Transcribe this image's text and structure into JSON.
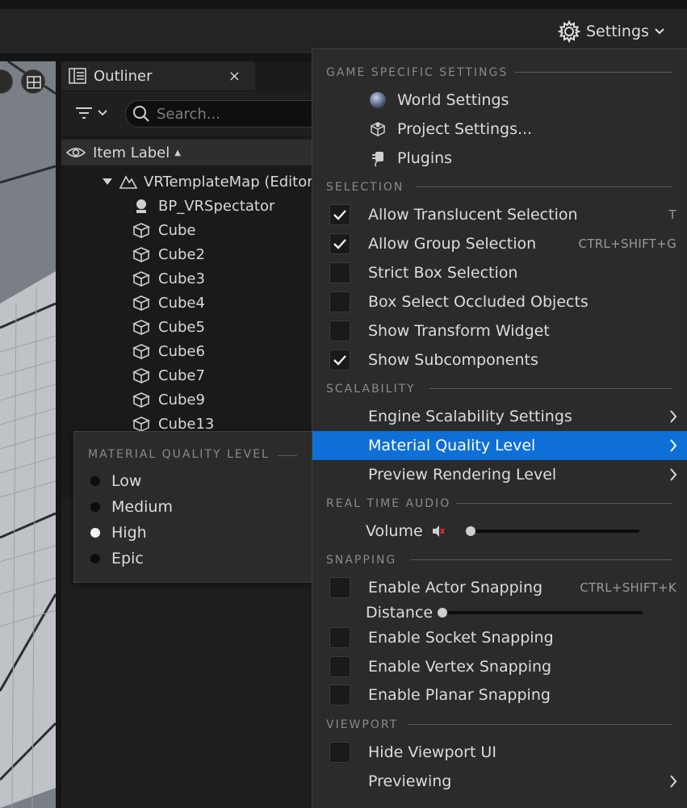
{
  "toolbar": {
    "settings_label": "Settings"
  },
  "outliner": {
    "tab_title": "Outliner",
    "close_glyph": "×",
    "search_placeholder": "Search...",
    "column_header": "Item Label",
    "sort_glyph": "▲",
    "root": "VRTemplateMap (Editor)",
    "items": [
      "BP_VRSpectator",
      "Cube",
      "Cube2",
      "Cube3",
      "Cube4",
      "Cube5",
      "Cube6",
      "Cube7",
      "Cube9",
      "Cube13"
    ]
  },
  "material_quality": {
    "header": "MATERIAL QUALITY LEVEL",
    "options": [
      "Low",
      "Medium",
      "High",
      "Epic"
    ],
    "selected": "High"
  },
  "menu": {
    "game_specific": {
      "header": "GAME SPECIFIC SETTINGS",
      "items": [
        {
          "label": "World Settings",
          "icon": "world-icon"
        },
        {
          "label": "Project Settings...",
          "icon": "project-settings-icon"
        },
        {
          "label": "Plugins",
          "icon": "plugins-icon"
        }
      ]
    },
    "selection": {
      "header": "SELECTION",
      "items": [
        {
          "label": "Allow Translucent Selection",
          "checked": true,
          "shortcut": "T"
        },
        {
          "label": "Allow Group Selection",
          "checked": true,
          "shortcut": "CTRL+SHIFT+G"
        },
        {
          "label": "Strict Box Selection",
          "checked": false,
          "shortcut": ""
        },
        {
          "label": "Box Select Occluded Objects",
          "checked": false,
          "shortcut": ""
        },
        {
          "label": "Show Transform Widget",
          "checked": false,
          "shortcut": ""
        },
        {
          "label": "Show Subcomponents",
          "checked": true,
          "shortcut": ""
        }
      ]
    },
    "scalability": {
      "header": "SCALABILITY",
      "items": [
        "Engine Scalability Settings",
        "Material Quality Level",
        "Preview Rendering Level"
      ],
      "highlighted": "Material Quality Level"
    },
    "audio": {
      "header": "REAL TIME AUDIO",
      "volume_label": "Volume",
      "volume_level": 0
    },
    "snapping": {
      "header": "SNAPPING",
      "actor_label": "Enable Actor Snapping",
      "actor_checked": false,
      "actor_shortcut": "CTRL+SHIFT+K",
      "distance_label": "Distance",
      "distance_level": 0,
      "socket_label": "Enable Socket Snapping",
      "vertex_label": "Enable Vertex Snapping",
      "planar_label": "Enable Planar Snapping"
    },
    "viewport": {
      "header": "VIEWPORT",
      "hide_ui_label": "Hide Viewport UI",
      "hide_ui_checked": false,
      "previewing_label": "Previewing"
    }
  },
  "colors": {
    "highlight": "#0e6fd6",
    "menu_bg": "#2b2b2b",
    "panel_bg": "#1a1a1a"
  }
}
